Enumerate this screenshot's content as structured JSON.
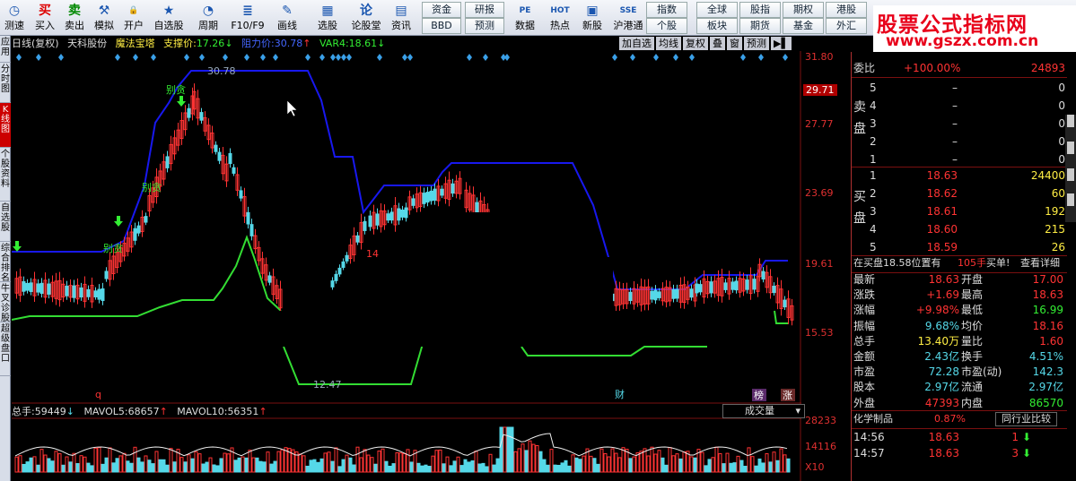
{
  "toolbar": {
    "buttons": [
      {
        "label": "测速",
        "icon": "speed-icon",
        "glyph": "◷"
      },
      {
        "label": "买入",
        "icon": "buy-icon",
        "glyph": "买"
      },
      {
        "label": "卖出",
        "icon": "sell-icon",
        "glyph": "卖"
      },
      {
        "label": "模拟",
        "icon": "simulate-icon",
        "glyph": "⚒"
      },
      {
        "label": "开户",
        "icon": "lock-icon",
        "glyph": "🔒"
      },
      {
        "label": "自选股",
        "icon": "star-icon",
        "glyph": "★"
      },
      {
        "label": "周期",
        "icon": "clock-icon",
        "glyph": "◔"
      },
      {
        "label": "F10/F9",
        "icon": "f10-icon",
        "glyph": "≣"
      },
      {
        "label": "画线",
        "icon": "pen-icon",
        "glyph": "✎"
      },
      {
        "label": "选股",
        "icon": "select-icon",
        "glyph": "▦"
      },
      {
        "label": "论股堂",
        "icon": "forum-icon",
        "glyph": "论"
      },
      {
        "label": "资讯",
        "icon": "news-icon",
        "glyph": "▤"
      },
      {
        "label": "数据",
        "icon": "data-icon",
        "glyph": "PE"
      },
      {
        "label": "热点",
        "icon": "hot-icon",
        "glyph": "HOT"
      },
      {
        "label": "新股",
        "icon": "newstock-icon",
        "glyph": "▣"
      },
      {
        "label": "沪港通",
        "icon": "hk-connect-icon",
        "glyph": "SSE"
      }
    ],
    "small_buttons": [
      {
        "label": "资金"
      },
      {
        "label": "BBD"
      },
      {
        "label": "研报"
      },
      {
        "label": "预测"
      },
      {
        "label": "指数"
      },
      {
        "label": "个股"
      },
      {
        "label": "全球"
      },
      {
        "label": "板块"
      },
      {
        "label": "股指"
      },
      {
        "label": "期货"
      },
      {
        "label": "期权"
      },
      {
        "label": "基金"
      },
      {
        "label": "港股"
      },
      {
        "label": "外汇"
      }
    ]
  },
  "logo": {
    "line1": "股票公式指标网",
    "line2": "www.gszx.com.cn"
  },
  "left_tabs": [
    "应用",
    "分时图",
    "K线图",
    "个股资料",
    "自选股",
    "综合排名",
    "牛叉诊股",
    "超级盘口"
  ],
  "chart_header": {
    "period": "日线(复权)",
    "stock": "天科股份",
    "indicator": "魔法宝塔",
    "support_label": "支撑价:",
    "support_value": "17.26",
    "resist_label": "阻力价:",
    "resist_value": "30.78",
    "var4_label": "VAR4:",
    "var4_value": "18.61"
  },
  "chart_tools": [
    "加自选",
    "均线",
    "复权",
    "叠",
    "窗",
    "预测"
  ],
  "price_axis": [
    "31.80",
    "29.71",
    "27.77",
    "23.69",
    "19.61",
    "15.53"
  ],
  "volume_axis": [
    "28233",
    "14116",
    "X10"
  ],
  "chart_annotations": {
    "peak": "30.78",
    "low": "12.47",
    "bie_tan": "别贪",
    "q": "q",
    "cai": "财",
    "bang": "榜",
    "zhang": "涨",
    "fourteen": "14"
  },
  "volume_header": {
    "total_label": "总手:",
    "total_value": "59449",
    "mavol5_label": "MAVOL5:",
    "mavol5_value": "68657",
    "mavol10_label": "MAVOL10:",
    "mavol10_value": "56351",
    "selector": "成交量"
  },
  "quote_panel": {
    "weibi_label": "委比",
    "weibi_pct": "+100.00%",
    "weibi_val": "24893",
    "sell_label": "卖盘",
    "buy_label": "买盘",
    "sell": [
      {
        "n": "5",
        "price": "–",
        "vol": "0"
      },
      {
        "n": "4",
        "price": "–",
        "vol": "0"
      },
      {
        "n": "3",
        "price": "–",
        "vol": "0"
      },
      {
        "n": "2",
        "price": "–",
        "vol": "0"
      },
      {
        "n": "1",
        "price": "–",
        "vol": "0"
      }
    ],
    "buy": [
      {
        "n": "1",
        "price": "18.63",
        "vol": "24400"
      },
      {
        "n": "2",
        "price": "18.62",
        "vol": "60"
      },
      {
        "n": "3",
        "price": "18.61",
        "vol": "192"
      },
      {
        "n": "4",
        "price": "18.60",
        "vol": "215"
      },
      {
        "n": "5",
        "price": "18.59",
        "vol": "26"
      }
    ],
    "notice": "在买盘18.58位置有",
    "notice_vol": "105手",
    "notice_buy": "买单!",
    "notice_link": "查看详细",
    "stats": [
      {
        "l1": "最新",
        "v1": "18.63",
        "l2": "开盘",
        "v2": "17.00"
      },
      {
        "l1": "涨跌",
        "v1": "+1.69",
        "l2": "最高",
        "v2": "18.63"
      },
      {
        "l1": "涨幅",
        "v1": "+9.98%",
        "l2": "最低",
        "v2": "16.99"
      },
      {
        "l1": "振幅",
        "v1": "9.68%",
        "l2": "均价",
        "v2": "18.16"
      },
      {
        "l1": "总手",
        "v1": "13.40万",
        "l2": "量比",
        "v2": "1.60"
      },
      {
        "l1": "金额",
        "v1": "2.43亿",
        "l2": "换手",
        "v2": "4.51%"
      },
      {
        "l1": "市盈",
        "v1": "72.28",
        "l2": "市盈(动)",
        "v2": "142.3"
      },
      {
        "l1": "股本",
        "v1": "2.97亿",
        "l2": "流通",
        "v2": "2.97亿"
      },
      {
        "l1": "外盘",
        "v1": "47393",
        "l2": "内盘",
        "v2": "86570"
      }
    ],
    "sector": "化学制品",
    "sector_pct": "0.87%",
    "sector_btn": "同行业比较",
    "ticks": [
      {
        "time": "14:56",
        "price": "18.63",
        "vol": "1"
      },
      {
        "time": "14:57",
        "price": "18.63",
        "vol": "3"
      }
    ]
  },
  "colors": {
    "resist": "#2020ff",
    "support": "#33dd33",
    "up": "#ff3333",
    "down": "#55d8e8"
  }
}
